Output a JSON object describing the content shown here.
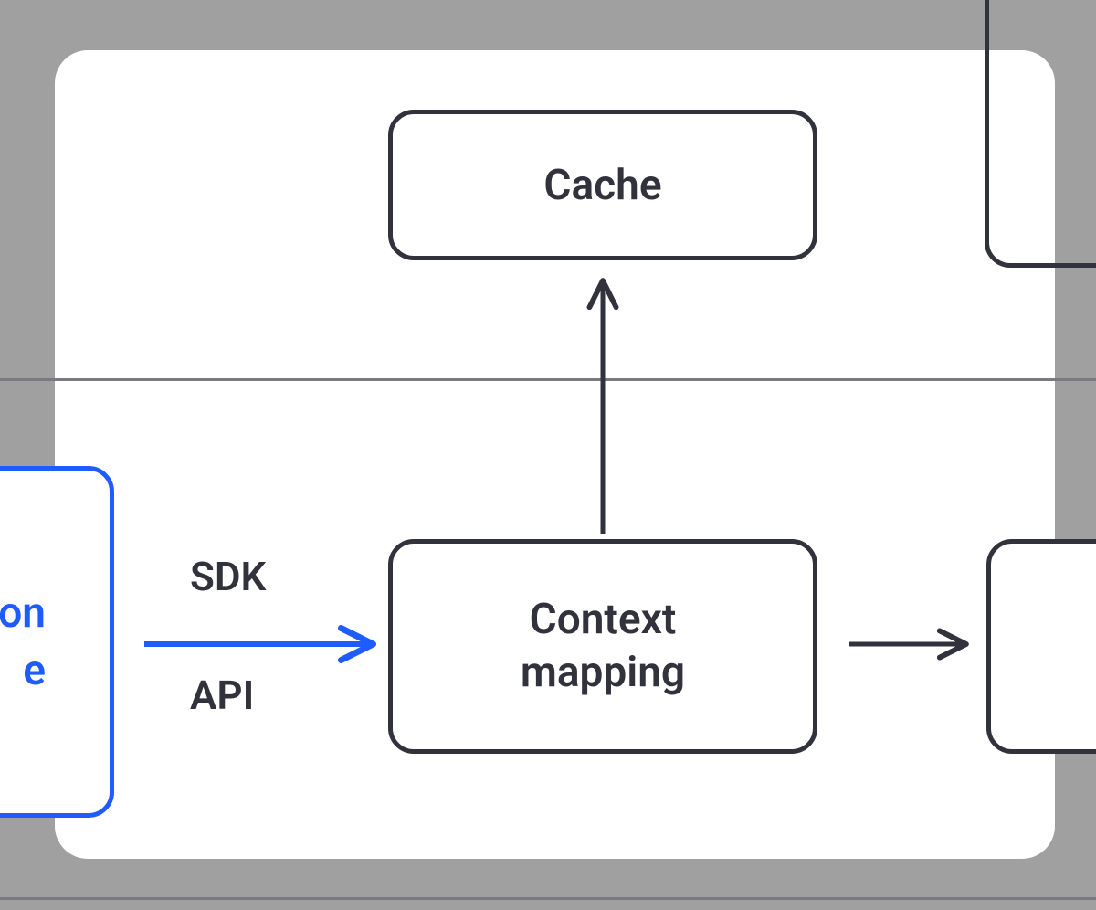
{
  "nodes": {
    "cache": {
      "label": "Cache"
    },
    "context_mapping": {
      "label": "Context\nmapping"
    },
    "left_partial": {
      "line1_fragment": "on",
      "line2_fragment": "e"
    }
  },
  "edges": {
    "sdk_api": {
      "top_label": "SDK",
      "bottom_label": "API"
    }
  },
  "colors": {
    "stroke": "#32323c",
    "accent": "#1f5cff",
    "panel_bg": "#ffffff",
    "page_bg": "#a0a0a0"
  }
}
